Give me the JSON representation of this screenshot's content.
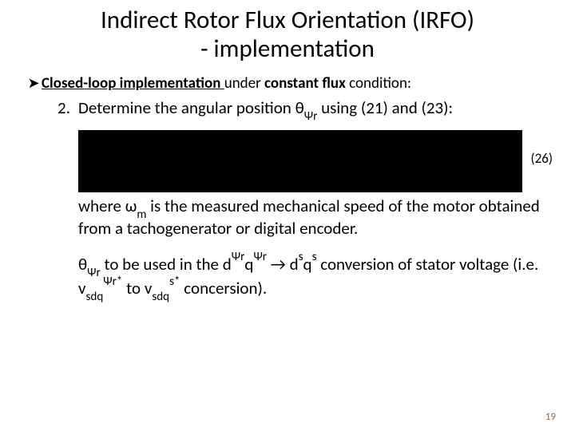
{
  "title_line1": "Indirect Rotor Flux Orientation (IRFO)",
  "title_line2": "- implementation",
  "bullet": {
    "part1_u_b": "Closed-loop implementation ",
    "part2": "under ",
    "part3_b": "constant flux",
    "part4": " condition:"
  },
  "step": {
    "num": "2.",
    "text1": "Determine the angular position ",
    "theta": "θ",
    "psi_sub": "Ψr",
    "text2": " using (21) and (23):"
  },
  "eqn_label": "(26)",
  "where": {
    "w1": "where ",
    "omega": "ω",
    "omega_sub": "m",
    "w2": " is the measured mechanical speed of the motor obtained from a tachogenerator or digital encoder."
  },
  "usage": {
    "theta": "θ",
    "psi_sub": "Ψr",
    "u1": " to be used in the d",
    "frame1_sup": "Ψr",
    "q": "q",
    "frame2_sup": "Ψr",
    "arrow": " → ",
    "ds": "d",
    "s_sup": "s",
    "qs": "q",
    "s_sup2": "s",
    "u2": " conversion of stator voltage (i.e. v",
    "v1_sub": "sdq",
    "v1_sup": "Ψr*",
    "u3": " to v",
    "v2_sub": "sdq",
    "v2_sup": "s*",
    "u4": " concersion)."
  },
  "page_num": "19"
}
